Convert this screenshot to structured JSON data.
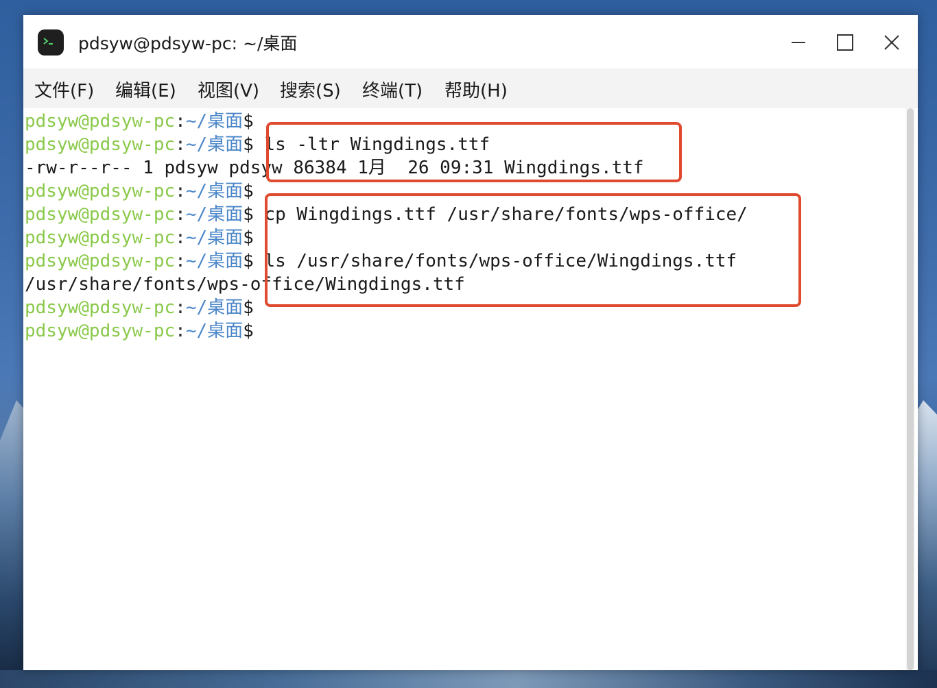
{
  "window": {
    "title": "pdsyw@pdsyw-pc: ~/桌面"
  },
  "menu": [
    {
      "label": "文件(F)"
    },
    {
      "label": "编辑(E)"
    },
    {
      "label": "视图(V)"
    },
    {
      "label": "搜索(S)"
    },
    {
      "label": "终端(T)"
    },
    {
      "label": "帮助(H)"
    }
  ],
  "prompt": {
    "user": "pdsyw@pdsyw-pc",
    "sep": ":",
    "path": "~/桌面",
    "symbol": "$"
  },
  "terminal": {
    "line1": "",
    "line2": "ls -ltr Wingdings.ttf",
    "line3_output": "-rw-r--r-- 1 pdsyw pdsyw 86384 1月  26 09:31 Wingdings.ttf",
    "line4": "",
    "line5": "cp Wingdings.ttf /usr/share/fonts/wps-office/",
    "line6": "",
    "line7": "ls /usr/share/fonts/wps-office/Wingdings.ttf",
    "line8_output": "/usr/share/fonts/wps-office/Wingdings.ttf",
    "line9": "",
    "line10": ""
  },
  "colors": {
    "prompt_user": "#8ac94a",
    "prompt_path": "#4a86c8",
    "highlight_box": "#e04a2f"
  },
  "icons": {
    "app": "terminal-icon",
    "minimize": "minimize-icon",
    "maximize": "maximize-icon",
    "close": "close-icon"
  }
}
